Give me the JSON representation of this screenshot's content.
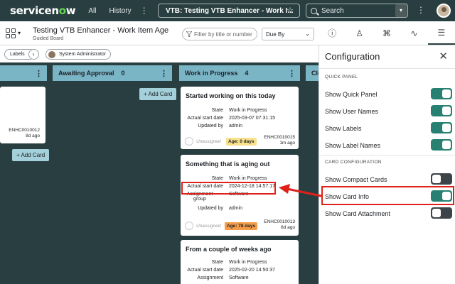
{
  "nav": {
    "logo_a": "servicen",
    "logo_o": "o",
    "logo_b": "w",
    "all": "All",
    "history": "History",
    "title": "VTB: Testing VTB Enhancer - Work I...",
    "search_placeholder": "Search"
  },
  "board": {
    "title": "Testing VTB Enhancer - Work Item Age",
    "subtitle": "Guided Board",
    "filter_placeholder": "Filter by title or number",
    "sort": "Due By",
    "labels_chip": "Labels",
    "user_chip": "System Administrator"
  },
  "lanes": [
    {
      "name": "",
      "count": ""
    },
    {
      "name": "Awaiting Approval",
      "count": "0"
    },
    {
      "name": "Work in Progress",
      "count": "4"
    },
    {
      "name": "Clo",
      "count": ""
    }
  ],
  "add_card": "+ Add Card",
  "lane0_card": {
    "number": "ENHC0010012",
    "age": "8d ago"
  },
  "cards": [
    {
      "title": "Started working on this today",
      "state_label": "State",
      "state": "Work in Progress",
      "start_label": "Actual start date",
      "start": "2025-03-07 07:31:15",
      "updated_label": "Updated by",
      "updated": "admin",
      "assignee": "Unassigned",
      "age_badge": "Age: 0 days",
      "number": "ENHC0010015",
      "ago": "1m ago"
    },
    {
      "title": "Something that is aging out",
      "state_label": "State",
      "state": "Work in Progress",
      "start_label": "Actual start date",
      "start": "2024-12-18 14:57:17",
      "group_label": "Assignment group",
      "group": "Software",
      "updated_label": "Updated by",
      "updated": "admin",
      "assignee": "Unassigned",
      "age_badge": "Age: 78 days",
      "number": "ENHC0010013",
      "ago": "8d ago"
    },
    {
      "title": "From a couple of weeks ago",
      "state_label": "State",
      "state": "Work in Progress",
      "start_label": "Actual start date",
      "start": "2025-02-20 14:50:37",
      "group_label": "Assignment",
      "group": "Software"
    }
  ],
  "panel": {
    "title": "Configuration",
    "quick_panel_section": "QUICK PANEL",
    "card_config_section": "CARD CONFIGURATION",
    "options": [
      {
        "label": "Show Quick Panel",
        "on": true
      },
      {
        "label": "Show User Names",
        "on": true
      },
      {
        "label": "Show Labels",
        "on": true
      },
      {
        "label": "Show Label Names",
        "on": true
      },
      {
        "label": "Show Compact Cards",
        "on": false
      },
      {
        "label": "Show Card Info",
        "on": true
      },
      {
        "label": "Show Card Attachment",
        "on": false
      }
    ]
  },
  "colors": {
    "nav_bg": "#293e40",
    "lane_header": "#7ab5c6",
    "toggle_on": "#278072",
    "annotation_red": "#e0211b"
  }
}
